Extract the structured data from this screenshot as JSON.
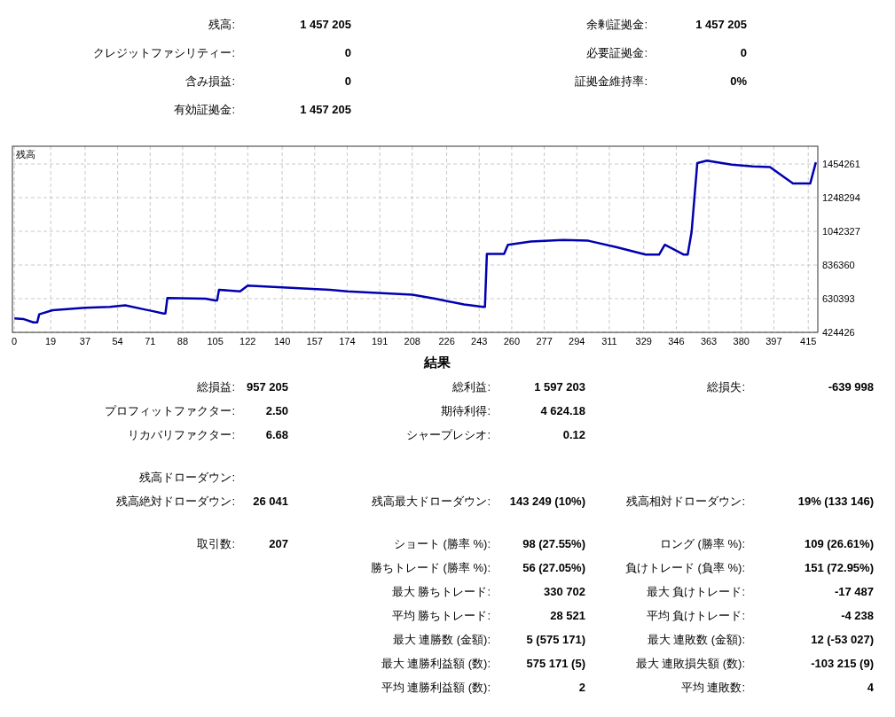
{
  "account": {
    "left": [
      {
        "label": "残高:",
        "value": "1 457 205"
      },
      {
        "label": "クレジットファシリティー:",
        "value": "0"
      },
      {
        "label": "含み損益:",
        "value": "0"
      },
      {
        "label": "有効証拠金:",
        "value": "1 457 205"
      }
    ],
    "right": [
      {
        "label": "余剰証拠金:",
        "value": "1 457 205"
      },
      {
        "label": "必要証拠金:",
        "value": "0"
      },
      {
        "label": "証拠金維持率:",
        "value": "0%"
      }
    ]
  },
  "chart": {
    "chart_data": {
      "type": "line",
      "grid": true,
      "xlim": [
        -1,
        420
      ],
      "ylim": [
        424426,
        1563000
      ],
      "xticks": [
        0,
        19,
        37,
        54,
        71,
        88,
        105,
        122,
        140,
        157,
        174,
        191,
        208,
        226,
        243,
        260,
        277,
        294,
        311,
        329,
        346,
        363,
        380,
        397,
        415
      ],
      "yticks": [
        424426,
        630393,
        836360,
        1042327,
        1248294,
        1454261
      ],
      "x": [
        0,
        5,
        10,
        12,
        13,
        20,
        37,
        50,
        58,
        68,
        72,
        78,
        79,
        80,
        100,
        105,
        106,
        107,
        118,
        122,
        140,
        165,
        174,
        208,
        220,
        235,
        245,
        246,
        247,
        256,
        258,
        270,
        287,
        300,
        315,
        330,
        337,
        340,
        350,
        352,
        354,
        357,
        362,
        375,
        386,
        395,
        401,
        407,
        416,
        419
      ],
      "series": [
        {
          "name": "残高",
          "color": "#0000b0",
          "values": [
            510000,
            505000,
            485000,
            485000,
            535000,
            560000,
            575000,
            580000,
            590000,
            565000,
            555000,
            540000,
            540000,
            635000,
            630000,
            620000,
            620000,
            685000,
            675000,
            710000,
            700000,
            685000,
            675000,
            655000,
            630000,
            595000,
            580000,
            580000,
            905000,
            905000,
            960000,
            980000,
            990000,
            985000,
            945000,
            900000,
            900000,
            960000,
            900000,
            900000,
            1040000,
            1460000,
            1475000,
            1450000,
            1440000,
            1435000,
            1385000,
            1335000,
            1335000,
            1465000
          ]
        }
      ]
    }
  },
  "results": {
    "title": "結果",
    "groups": [
      [
        {
          "left": {
            "label": "総損益:",
            "value": "957 205"
          },
          "middle": {
            "label": "総利益:",
            "value": "1 597 203"
          },
          "right": {
            "label": "総損失:",
            "value": "-639 998"
          }
        },
        {
          "left": {
            "label": "プロフィットファクター:",
            "value": "2.50"
          },
          "middle": {
            "label": "期待利得:",
            "value": "4 624.18"
          }
        },
        {
          "left": {
            "label": "リカバリファクター:",
            "value": "6.68"
          },
          "middle": {
            "label": "シャープレシオ:",
            "value": "0.12"
          }
        }
      ],
      [
        {
          "left": {
            "label": "残高ドローダウン:"
          }
        },
        {
          "left": {
            "label": "残高絶対ドローダウン:",
            "value": "26 041"
          },
          "middle": {
            "label": "残高最大ドローダウン:",
            "value": "143 249 (10%)"
          },
          "right": {
            "label": "残高相対ドローダウン:",
            "value": "19% (133 146)"
          }
        }
      ],
      [
        {
          "left": {
            "label": "取引数:",
            "value": "207"
          },
          "middle": {
            "label": "ショート (勝率 %):",
            "value": "98 (27.55%)"
          },
          "right": {
            "label": "ロング (勝率 %):",
            "value": "109 (26.61%)"
          }
        },
        {
          "middle": {
            "label": "勝ちトレード (勝率 %):",
            "value": "56 (27.05%)"
          },
          "right": {
            "label": "負けトレード (負率 %):",
            "value": "151 (72.95%)"
          }
        },
        {
          "middle": {
            "label": "最大 勝ちトレード:",
            "value": "330 702"
          },
          "right": {
            "label": "最大 負けトレード:",
            "value": "-17 487"
          }
        },
        {
          "middle": {
            "label": "平均 勝ちトレード:",
            "value": "28 521"
          },
          "right": {
            "label": "平均 負けトレード:",
            "value": "-4 238"
          }
        },
        {
          "middle": {
            "label": "最大 連勝数 (金額):",
            "value": "5 (575 171)"
          },
          "right": {
            "label": "最大 連敗数 (金額):",
            "value": "12 (-53 027)"
          }
        },
        {
          "middle": {
            "label": "最大 連勝利益額 (数):",
            "value": "575 171 (5)"
          },
          "right": {
            "label": "最大 連敗損失額 (数):",
            "value": "-103 215 (9)"
          }
        },
        {
          "middle": {
            "label": "平均 連勝利益額 (数):",
            "value": "2"
          },
          "right": {
            "label": "平均 連敗数:",
            "value": "4"
          }
        }
      ]
    ]
  }
}
